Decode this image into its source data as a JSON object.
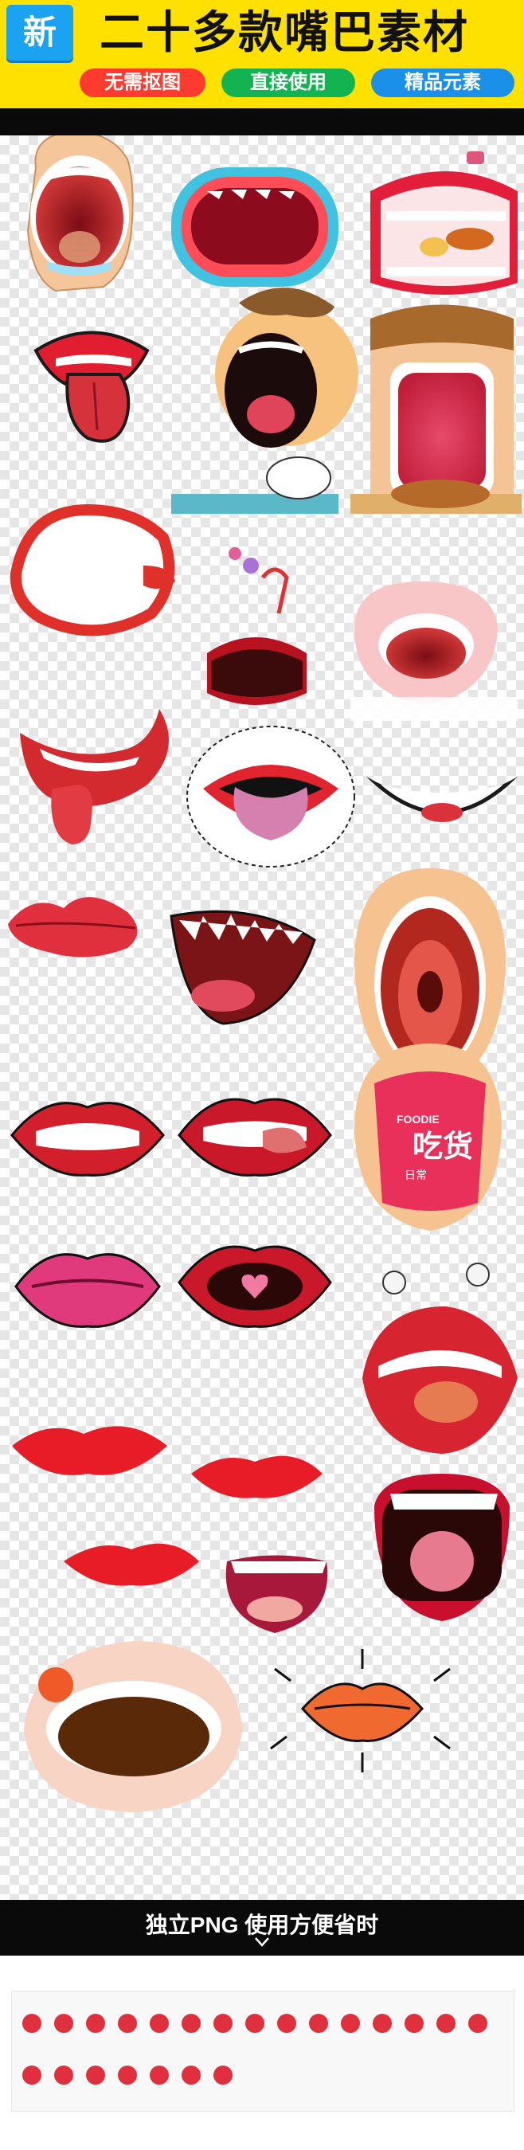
{
  "header": {
    "badge": "新",
    "title": "二十多款嘴巴素材",
    "pills": [
      "无需抠图",
      "直接使用",
      "精品元素"
    ]
  },
  "illustration": {
    "food_text_1": "FOODIE",
    "food_text_2": "吃货",
    "food_text_3": "日常"
  },
  "footer": {
    "caption": "独立PNG 使用方便省时"
  },
  "colors": {
    "header_bg": "#ffe100",
    "badge_bg": "#1aa3f0",
    "pill_red": "#ff3b30",
    "pill_green": "#14b352",
    "pill_blue": "#1a90e8",
    "band_black": "#0a0a0a"
  }
}
